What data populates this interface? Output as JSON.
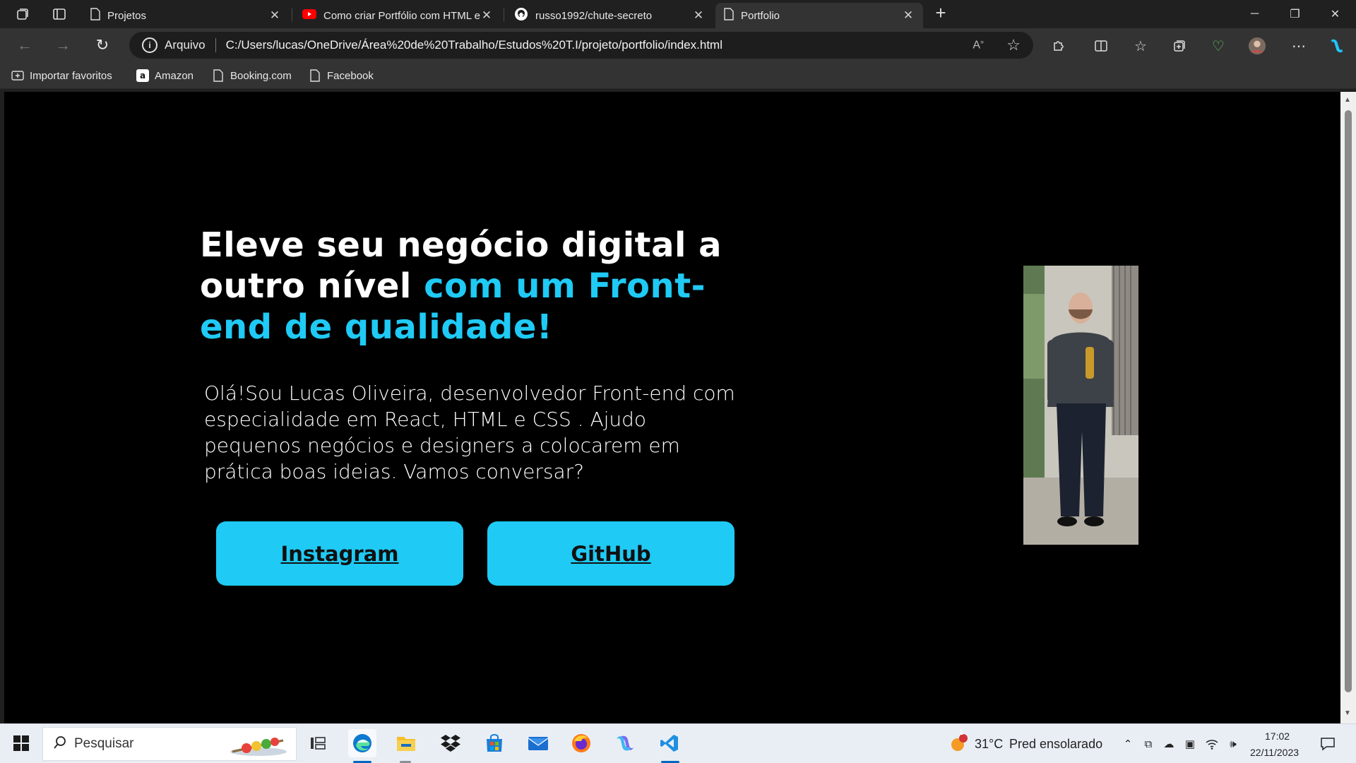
{
  "browser": {
    "tabs": [
      {
        "label": "Projetos",
        "icon": "page-icon",
        "active": false
      },
      {
        "label": "Como criar Portfólio com HTML e CSS",
        "icon": "youtube-icon",
        "active": false
      },
      {
        "label": "russo1992/chute-secreto",
        "icon": "github-icon",
        "active": false
      },
      {
        "label": "Portfolio",
        "icon": "page-icon",
        "active": true
      }
    ],
    "address": {
      "scheme_label": "Arquivo",
      "url": "C:/Users/lucas/OneDrive/Área%20de%20Trabalho/Estudos%20T.I/projeto/portfolio/index.html"
    },
    "favorites": [
      {
        "label": "Importar favoritos",
        "icon": "import-icon"
      },
      {
        "label": "Amazon",
        "icon": "amazon-icon"
      },
      {
        "label": "Booking.com",
        "icon": "page-icon"
      },
      {
        "label": "Facebook",
        "icon": "page-icon"
      }
    ]
  },
  "page": {
    "title_plain": "Eleve seu negócio digital a outro nível ",
    "title_highlight": "com um Front-end de qualidade!",
    "intro": "Olá!Sou Lucas Oliveira, desenvolvedor Front-end com especialidade em React, HTML e CSS . Ajudo pequenos negócios e designers a colocarem em prática boas ideias. Vamos conversar?",
    "buttons": {
      "instagram": "Instagram",
      "github": "GitHub"
    },
    "colors": {
      "background": "#000000",
      "accent": "#1fcaf5",
      "text": "#ffffff"
    }
  },
  "taskbar": {
    "search_placeholder": "Pesquisar",
    "weather": {
      "temp": "31°C",
      "desc": "Pred ensolarado",
      "alert_count": "1"
    },
    "clock": {
      "time": "17:02",
      "date": "22/11/2023"
    }
  }
}
